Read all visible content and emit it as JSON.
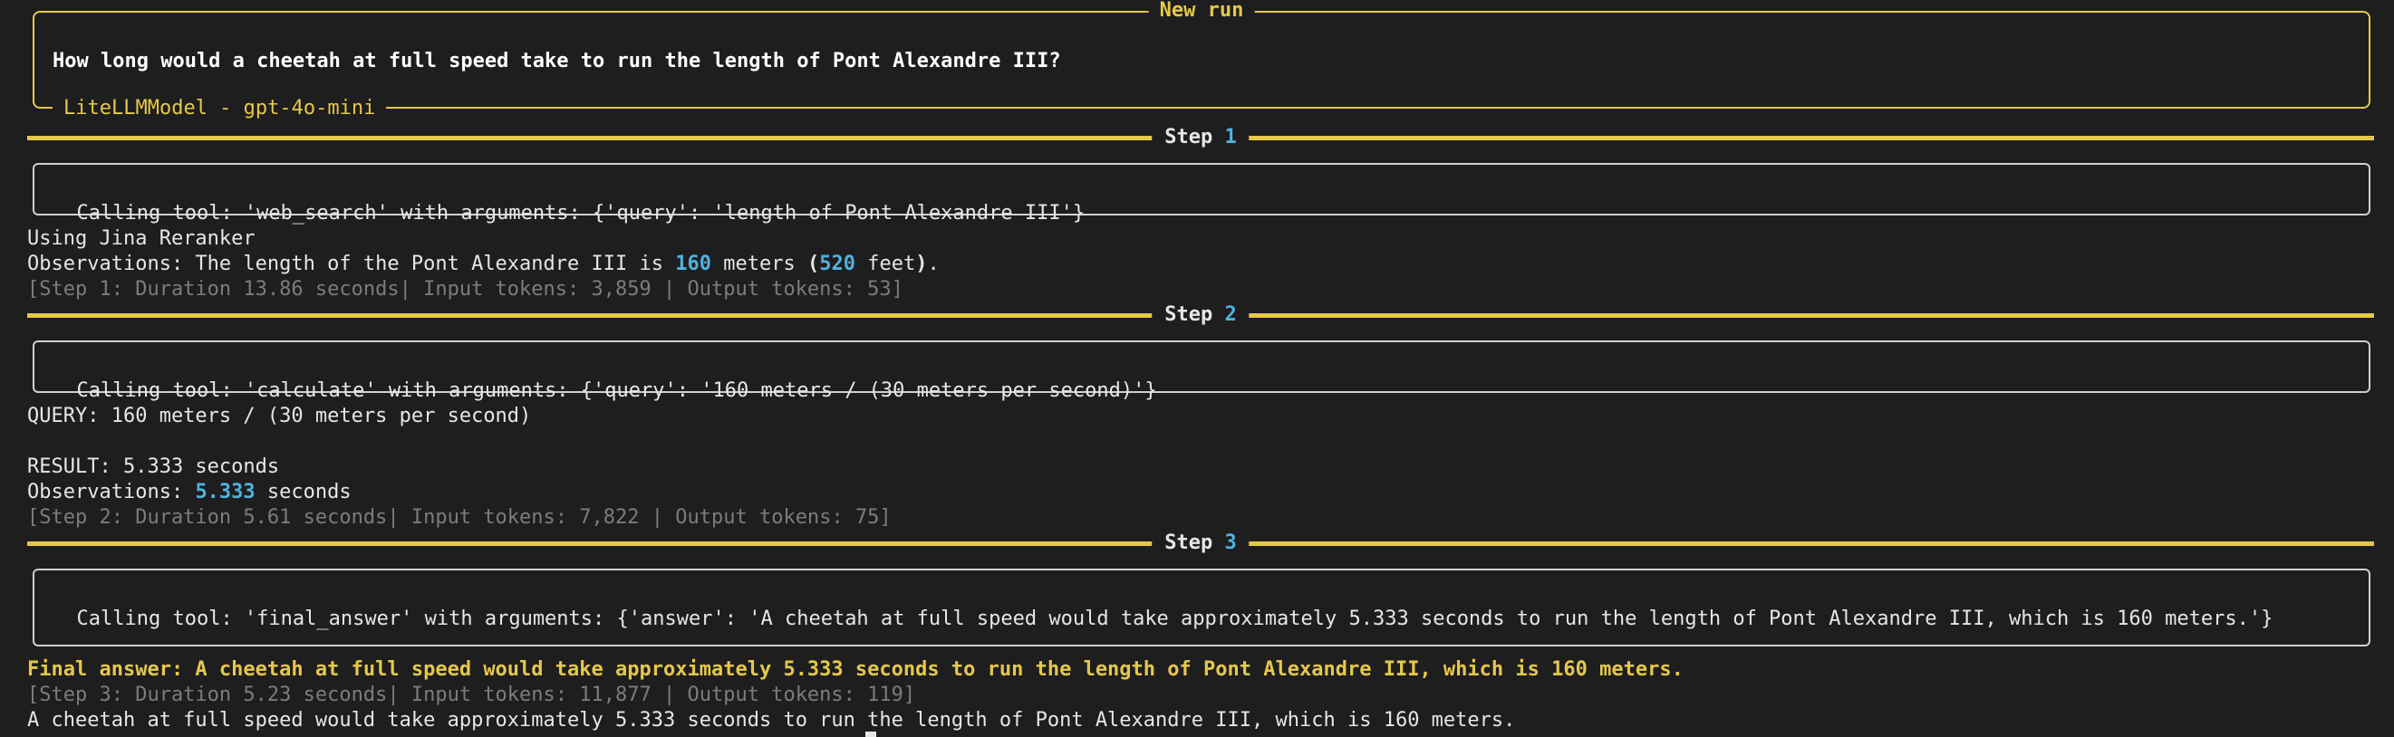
{
  "run": {
    "title": "New run",
    "task": "How long would a cheetah at full speed take to run the length of Pont Alexandre III?",
    "model": "LiteLLMModel - gpt-4o-mini"
  },
  "steps": [
    {
      "label": "Step",
      "number": "1",
      "tool_call": "Calling tool: 'web_search' with arguments: {'query': 'length of Pont Alexandre III'}",
      "log_line": "Using Jina Reranker",
      "obs_prefix": "Observations: The length of the Pont Alexandre III is ",
      "obs_num1": "160",
      "obs_mid1": " meters ",
      "obs_paren_open": "(",
      "obs_num2": "520",
      "obs_mid2": " feet",
      "obs_paren_close": ")",
      "obs_end": ".",
      "stats": "[Step 1: Duration 13.86 seconds| Input tokens: 3,859 | Output tokens: 53]"
    },
    {
      "label": "Step",
      "number": "2",
      "tool_call": "Calling tool: 'calculate' with arguments: {'query': '160 meters / (30 meters per second)'}",
      "query_line": "QUERY: 160 meters / (30 meters per second)",
      "result_line": "RESULT: 5.333 seconds",
      "obs_prefix": "Observations: ",
      "obs_num": "5.333",
      "obs_suffix": " seconds",
      "stats": "[Step 2: Duration 5.61 seconds| Input tokens: 7,822 | Output tokens: 75]"
    },
    {
      "label": "Step",
      "number": "3",
      "tool_call": "Calling tool: 'final_answer' with arguments: {'answer': 'A cheetah at full speed would take approximately 5.333 seconds to run the length of Pont Alexandre III, which is 160 meters.'}",
      "final_answer": "Final answer: A cheetah at full speed would take approximately 5.333 seconds to run the length of Pont Alexandre III, which is 160 meters.",
      "stats": "[Step 3: Duration 5.23 seconds| Input tokens: 11,877 | Output tokens: 119]"
    }
  ],
  "final_output": "A cheetah at full speed would take approximately 5.333 seconds to run the length of Pont Alexandre III, which is 160 meters.",
  "colors": {
    "background": "#1e1e1e",
    "accent_yellow": "#e5c84a",
    "number_cyan": "#4fb3e0",
    "dim_text": "#7c7c7c",
    "text": "#e6e6e6"
  }
}
